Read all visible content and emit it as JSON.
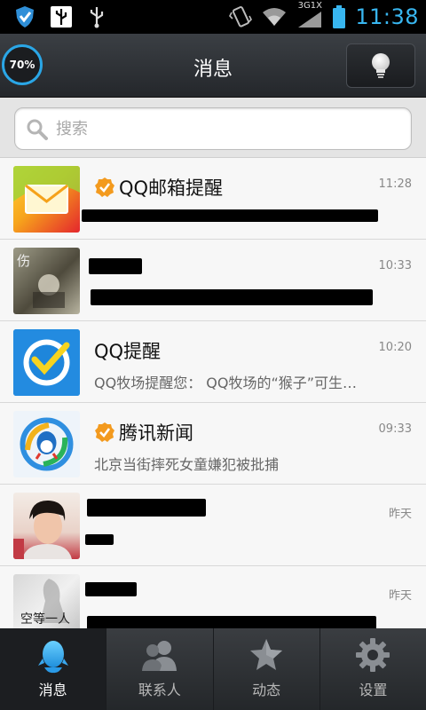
{
  "status_bar": {
    "time": "11:38",
    "network": "3G1X"
  },
  "header": {
    "progress_text": "70%",
    "title": "消息"
  },
  "search": {
    "placeholder": "搜索"
  },
  "conversations": [
    {
      "name": "QQ邮箱提醒",
      "time": "11:28",
      "preview": "",
      "verified": true
    },
    {
      "name": "",
      "time": "10:33",
      "preview": ""
    },
    {
      "name": "QQ提醒",
      "time": "10:20",
      "preview": "QQ牧场提醒您： QQ牧场的“猴子”可生…"
    },
    {
      "name": "腾讯新闻",
      "time": "09:33",
      "preview": "北京当街摔死女童嫌犯被批捕",
      "verified": true
    },
    {
      "name": "",
      "time": "昨天",
      "preview": ""
    },
    {
      "name": "",
      "time": "昨天",
      "preview": ""
    }
  ],
  "avatar_texts": {
    "item2": "伤",
    "item6": "空等一人"
  },
  "tabs": [
    {
      "label": "消息"
    },
    {
      "label": "联系人"
    },
    {
      "label": "动态"
    },
    {
      "label": "设置"
    }
  ],
  "colors": {
    "accent": "#38b6f0",
    "verified": "#f39a1e"
  }
}
